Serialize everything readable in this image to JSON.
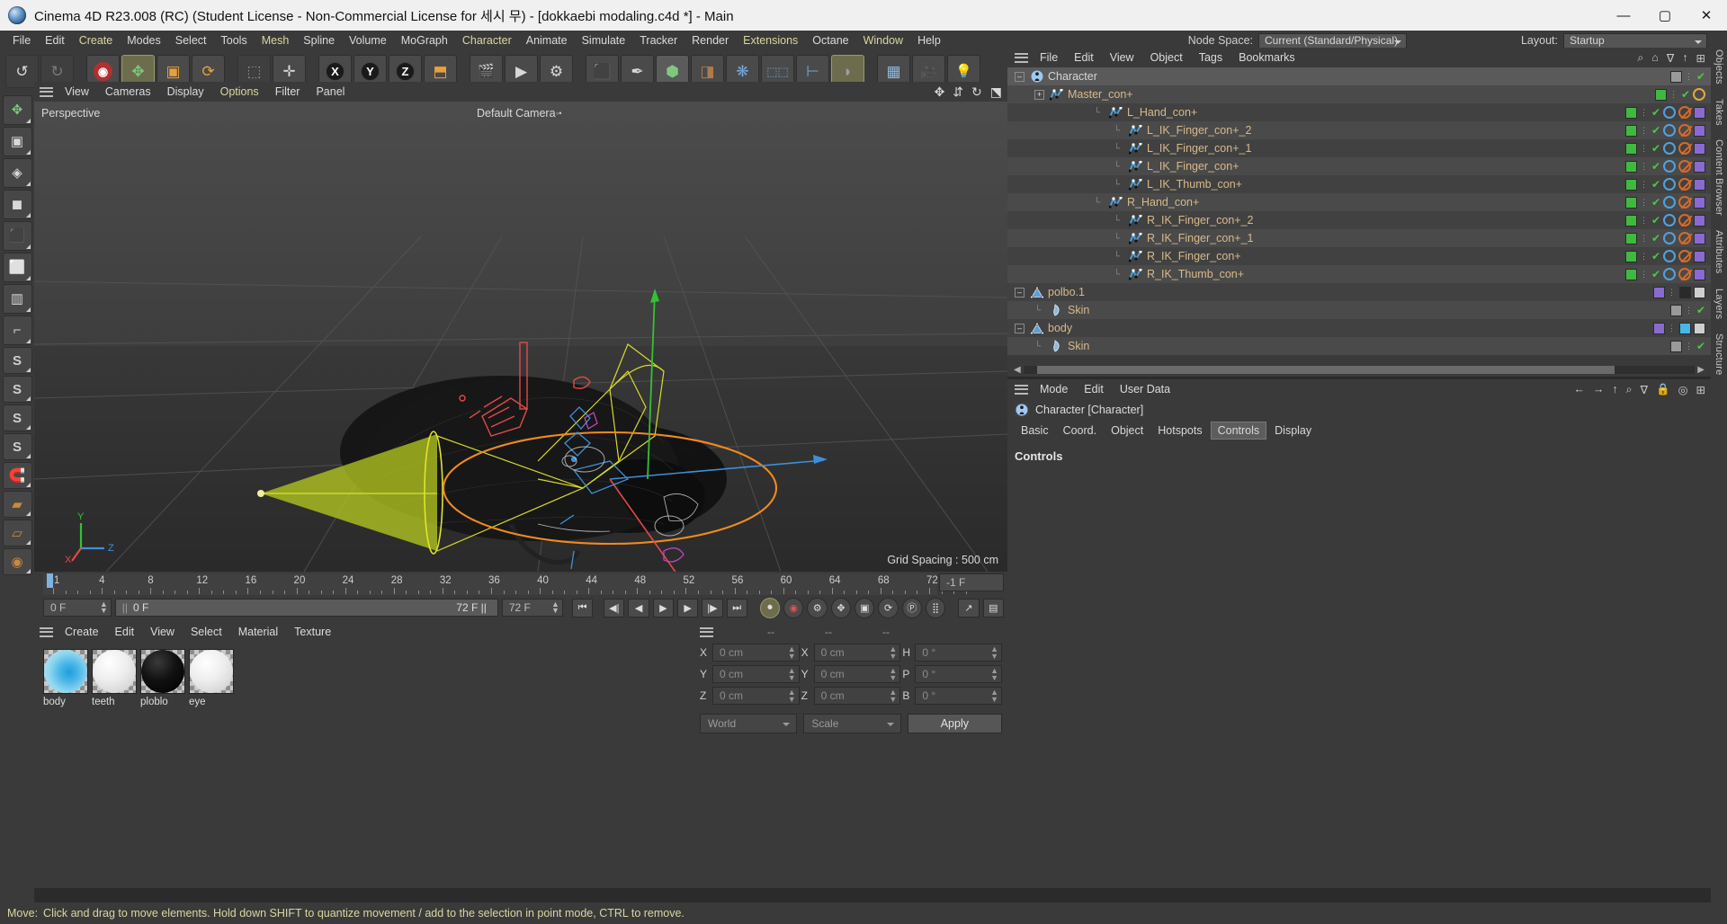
{
  "window": {
    "title": "Cinema 4D R23.008 (RC) (Student License - Non-Commercial License for 세시 무) - [dokkaebi modaling.c4d *] - Main",
    "minimize": "—",
    "maximize": "▢",
    "close": "✕"
  },
  "menubar": {
    "items": [
      {
        "label": "File",
        "color": "white"
      },
      {
        "label": "Edit",
        "color": "white"
      },
      {
        "label": "Create",
        "color": "green"
      },
      {
        "label": "Modes",
        "color": "white"
      },
      {
        "label": "Select",
        "color": "white"
      },
      {
        "label": "Tools",
        "color": "white"
      },
      {
        "label": "Mesh",
        "color": "green"
      },
      {
        "label": "Spline",
        "color": "white"
      },
      {
        "label": "Volume",
        "color": "white"
      },
      {
        "label": "MoGraph",
        "color": "white"
      },
      {
        "label": "Character",
        "color": "green"
      },
      {
        "label": "Animate",
        "color": "white"
      },
      {
        "label": "Simulate",
        "color": "white"
      },
      {
        "label": "Tracker",
        "color": "white"
      },
      {
        "label": "Render",
        "color": "white"
      },
      {
        "label": "Extensions",
        "color": "green"
      },
      {
        "label": "Octane",
        "color": "white"
      },
      {
        "label": "Window",
        "color": "green"
      },
      {
        "label": "Help",
        "color": "white"
      }
    ],
    "node_space_label": "Node Space:",
    "node_space_value": "Current (Standard/Physical)",
    "layout_label": "Layout:",
    "layout_value": "Startup"
  },
  "toolbar": {
    "undo": "↺",
    "redo": "↻",
    "live_selection": "◉",
    "move": "✥",
    "scale": "▣",
    "rotate": "⟳",
    "lock_axis": "⬚",
    "world_axis": "✛",
    "axis_x": "X",
    "axis_y": "Y",
    "axis_z": "Z",
    "coord_system": "⬒",
    "render_view": "🎬",
    "render_picture": "▶",
    "render_settings": "⚙",
    "cube": "⬛",
    "pen": "✒",
    "array": "⬢",
    "deformer": "◨",
    "generator": "❋",
    "mograph": "⬚⬚",
    "scene_node": "⊢",
    "field": "◗",
    "env": "▦",
    "camera": "🎥",
    "light": "💡"
  },
  "left_toolbar": {
    "items": [
      {
        "name": "move-tool",
        "glyph": "✥"
      },
      {
        "name": "point-mode",
        "glyph": "▣"
      },
      {
        "name": "edge-mode",
        "glyph": "◈"
      },
      {
        "name": "polygon-mode",
        "glyph": "◼"
      },
      {
        "name": "model-mode",
        "glyph": "⬛"
      },
      {
        "name": "object-mode",
        "glyph": "⬜"
      },
      {
        "name": "texture-mode",
        "glyph": "▥"
      },
      {
        "name": "workplane",
        "glyph": "⌐"
      },
      {
        "name": "snap-s1",
        "glyph": "S"
      },
      {
        "name": "snap-s2",
        "glyph": "S"
      },
      {
        "name": "snap-s3",
        "glyph": "S"
      },
      {
        "name": "snap-s4",
        "glyph": "S"
      },
      {
        "name": "magnet",
        "glyph": "🧲"
      },
      {
        "name": "grid-a",
        "glyph": "▰"
      },
      {
        "name": "grid-b",
        "glyph": "▱"
      },
      {
        "name": "spiral",
        "glyph": "◉"
      }
    ]
  },
  "right_strip": {
    "tabs": [
      "Objects",
      "Takes",
      "Content Browser",
      "Attributes",
      "Layers",
      "Structure"
    ]
  },
  "viewport": {
    "menu": [
      {
        "label": "View",
        "color": "white"
      },
      {
        "label": "Cameras",
        "color": "white"
      },
      {
        "label": "Display",
        "color": "white"
      },
      {
        "label": "Options",
        "color": "green"
      },
      {
        "label": "Filter",
        "color": "white"
      },
      {
        "label": "Panel",
        "color": "white"
      }
    ],
    "perspective_label": "Perspective",
    "camera_label": "Default Camera",
    "grid_spacing": "Grid Spacing : 500 cm",
    "axis_x": "X",
    "axis_y": "Y",
    "axis_z": "Z",
    "icons": [
      "move-view-icon",
      "pan-view-icon",
      "rotate-view-icon",
      "maximize-view-icon"
    ]
  },
  "timeline": {
    "ticks": [
      "-1",
      "4",
      "8",
      "12",
      "16",
      "20",
      "24",
      "28",
      "32",
      "36",
      "40",
      "44",
      "48",
      "52",
      "56",
      "60",
      "64",
      "68",
      "72"
    ],
    "current_frame_field": "-1 F",
    "start_frame": "0 F",
    "playhead_frame": "0 F",
    "end_frame_label": "72 F",
    "preview_end": "72 F",
    "transport": {
      "goto_start": "⏮",
      "step_back": "◀|",
      "prev_key": "◀",
      "play": "▶",
      "next_key": "▶",
      "step_forward": "|▶",
      "goto_end": "⏭",
      "record": "⏺",
      "autokey": "◉",
      "keyframe_settings": "⚙",
      "pos": "✥",
      "scale": "▣",
      "rot": "⟳",
      "param": "Ⓟ",
      "pla": "⣿",
      "curves": "↗",
      "dopesheet": "▤"
    }
  },
  "materials": {
    "menu": [
      "Create",
      "Edit",
      "View",
      "Select",
      "Material",
      "Texture"
    ],
    "items": [
      {
        "name": "body",
        "color": "#49b6e8",
        "type": "blue-sphere"
      },
      {
        "name": "teeth",
        "color": "#e8e8e8",
        "type": "white-sphere"
      },
      {
        "name": "ploblo",
        "color": "#101010",
        "type": "black-sphere"
      },
      {
        "name": "eye",
        "color": "#e2e2e2",
        "type": "white-sphere"
      }
    ]
  },
  "coordinates": {
    "header": [
      "--",
      "--",
      "--"
    ],
    "position": [
      {
        "axis": "X",
        "value": "0 cm"
      },
      {
        "axis": "Y",
        "value": "0 cm"
      },
      {
        "axis": "Z",
        "value": "0 cm"
      }
    ],
    "size": [
      {
        "axis": "X",
        "value": "0 cm"
      },
      {
        "axis": "Y",
        "value": "0 cm"
      },
      {
        "axis": "Z",
        "value": "0 cm"
      }
    ],
    "rotation": [
      {
        "axis": "H",
        "value": "0 °"
      },
      {
        "axis": "P",
        "value": "0 °"
      },
      {
        "axis": "B",
        "value": "0 °"
      }
    ],
    "space_select": "World",
    "mode_select": "Scale",
    "apply_button": "Apply"
  },
  "object_manager": {
    "menu": [
      "File",
      "Edit",
      "View",
      "Object",
      "Tags",
      "Bookmarks"
    ],
    "icons": [
      "search-icon",
      "home-icon",
      "filter-icon",
      "up-icon",
      "settings-icon"
    ],
    "rows": [
      {
        "label": "Character",
        "indent": 0,
        "icon": "character-icon",
        "expander": "minus",
        "color": "white",
        "tags": "character"
      },
      {
        "label": "Master_con+",
        "indent": 1,
        "icon": "spline-icon",
        "expander": "plus",
        "color": "tan",
        "tags": "green-circle"
      },
      {
        "label": "L_Hand_con+",
        "indent": 4,
        "icon": "spline-icon",
        "expander": "none",
        "color": "tan",
        "tags": "full"
      },
      {
        "label": "L_IK_Finger_con+_2",
        "indent": 5,
        "icon": "spline-icon",
        "expander": "none",
        "color": "tan",
        "tags": "full"
      },
      {
        "label": "L_IK_Finger_con+_1",
        "indent": 5,
        "icon": "spline-icon",
        "expander": "none",
        "color": "tan",
        "tags": "full"
      },
      {
        "label": "L_IK_Finger_con+",
        "indent": 5,
        "icon": "spline-icon",
        "expander": "none",
        "color": "tan",
        "tags": "full"
      },
      {
        "label": "L_IK_Thumb_con+",
        "indent": 5,
        "icon": "spline-icon",
        "expander": "none",
        "color": "tan",
        "tags": "full"
      },
      {
        "label": "R_Hand_con+",
        "indent": 4,
        "icon": "spline-icon",
        "expander": "none",
        "color": "tan",
        "tags": "full"
      },
      {
        "label": "R_IK_Finger_con+_2",
        "indent": 5,
        "icon": "spline-icon",
        "expander": "none",
        "color": "tan",
        "tags": "full"
      },
      {
        "label": "R_IK_Finger_con+_1",
        "indent": 5,
        "icon": "spline-icon",
        "expander": "none",
        "color": "tan",
        "tags": "full"
      },
      {
        "label": "R_IK_Finger_con+",
        "indent": 5,
        "icon": "spline-icon",
        "expander": "none",
        "color": "tan",
        "tags": "full"
      },
      {
        "label": "R_IK_Thumb_con+",
        "indent": 5,
        "icon": "spline-icon",
        "expander": "none",
        "color": "tan",
        "tags": "full"
      },
      {
        "label": "polbo.1",
        "indent": 0,
        "icon": "mesh-icon",
        "expander": "minus",
        "color": "tan",
        "tags": "mesh"
      },
      {
        "label": "Skin",
        "indent": 1,
        "icon": "skin-icon",
        "expander": "none",
        "color": "tan",
        "tags": "simple"
      },
      {
        "label": "body",
        "indent": 0,
        "icon": "mesh-icon",
        "expander": "minus",
        "color": "tan",
        "tags": "mesh2"
      },
      {
        "label": "Skin",
        "indent": 1,
        "icon": "skin-icon",
        "expander": "none",
        "color": "tan",
        "tags": "simple"
      }
    ]
  },
  "attributes": {
    "menu": [
      "Mode",
      "Edit",
      "User Data"
    ],
    "icons": [
      "back-arrow-icon",
      "forward-arrow-icon",
      "up-arrow-icon",
      "search-icon",
      "filter-icon",
      "lock-icon",
      "target-icon",
      "plus-icon"
    ],
    "object_title": "Character [Character]",
    "tabs": [
      {
        "label": "Basic",
        "selected": false
      },
      {
        "label": "Coord.",
        "selected": false
      },
      {
        "label": "Object",
        "selected": false
      },
      {
        "label": "Hotspots",
        "selected": false
      },
      {
        "label": "Controls",
        "selected": true
      },
      {
        "label": "Display",
        "selected": false
      }
    ],
    "section_title": "Controls"
  },
  "status_bar": {
    "label": "Move:",
    "text": "Click and drag to move elements. Hold down SHIFT to quantize movement / add to the selection in point mode, CTRL to remove."
  },
  "colors": {
    "accent_green": "#d9d7a0",
    "object_tan": "#d8b98a",
    "panel_bg": "#3a3a3a",
    "row_odd": "#414141",
    "row_even": "#4a4a4a",
    "tag_green": "#3fb93f"
  }
}
